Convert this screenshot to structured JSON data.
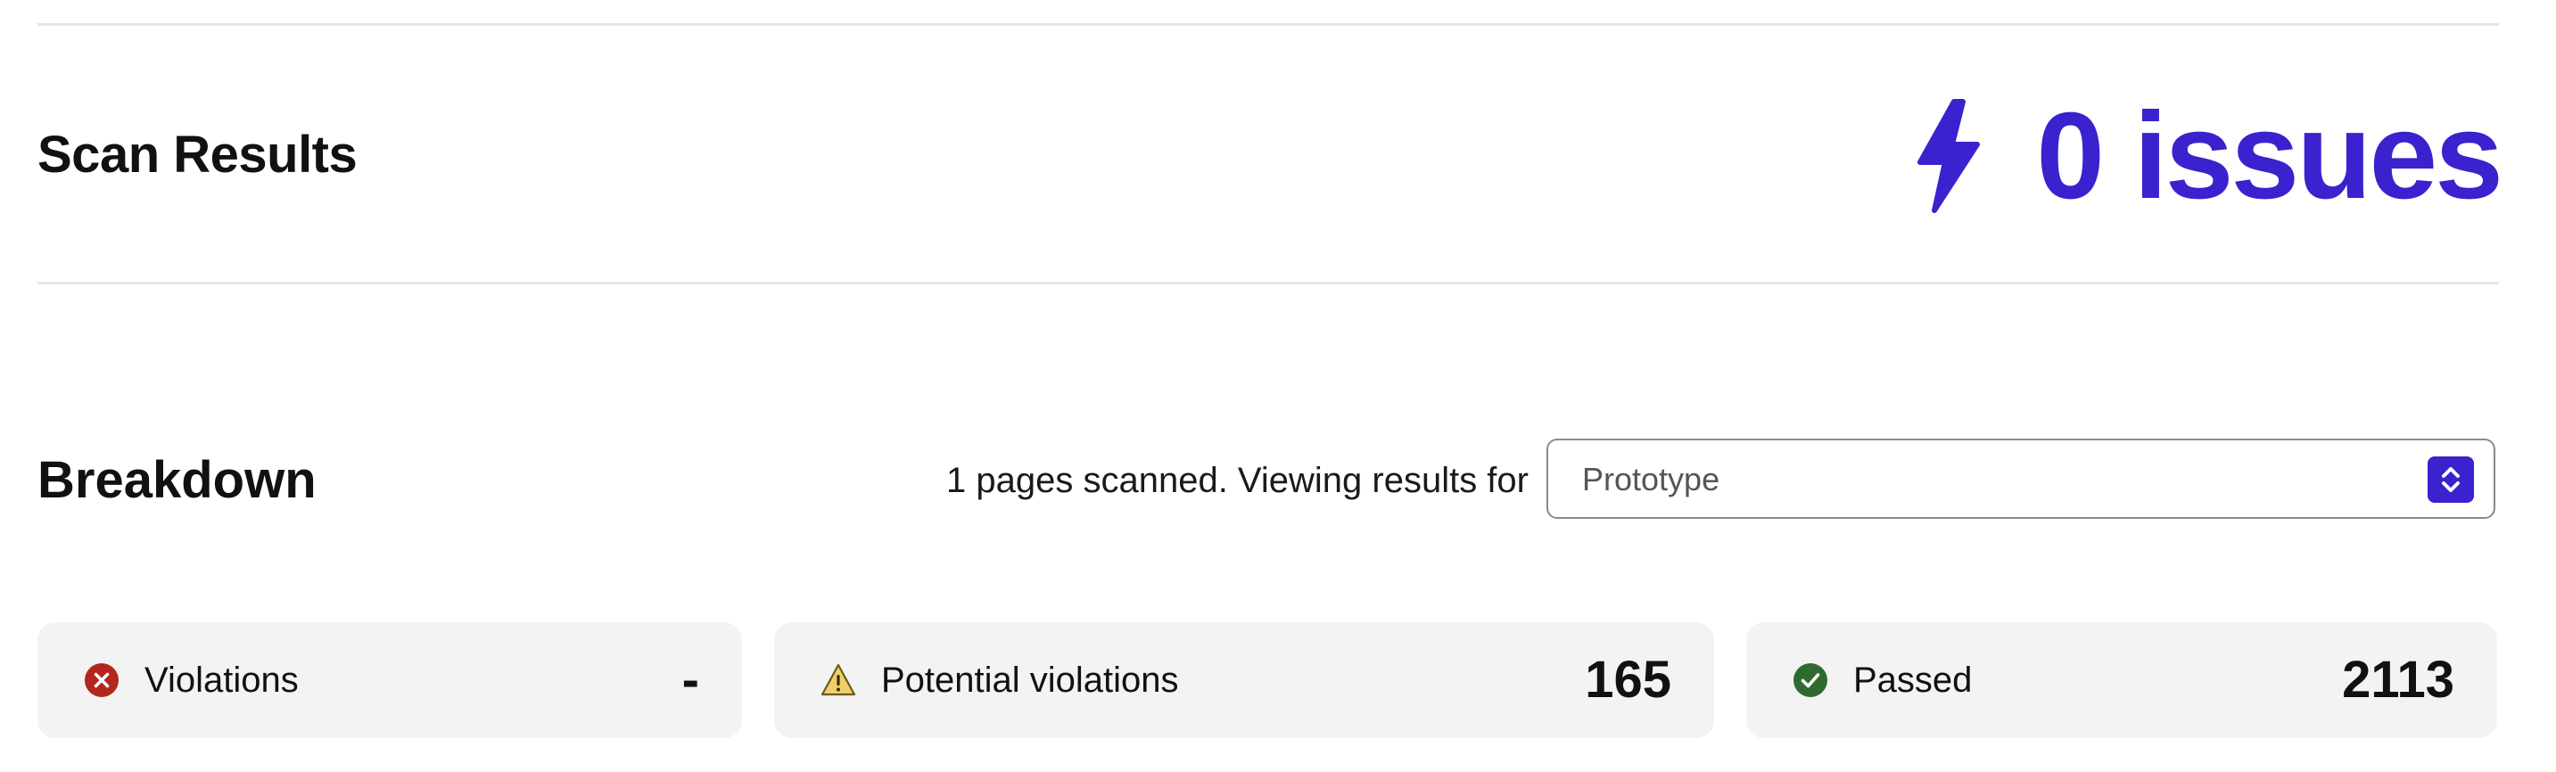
{
  "scan": {
    "title": "Scan Results",
    "issues_label": "0 issues",
    "accent_color": "#3a22cf",
    "icon": "lightning-bolt-icon"
  },
  "breakdown": {
    "title": "Breakdown",
    "scanned_text": "1 pages scanned. Viewing results for",
    "select": {
      "value": "Prototype",
      "icon": "chevron-up-down-icon"
    }
  },
  "cards": [
    {
      "label": "Violations",
      "value": "-",
      "icon": "error-circle-icon",
      "color": "#b3261e"
    },
    {
      "label": "Potential violations",
      "value": "165",
      "icon": "warning-triangle-icon",
      "color": "#e0b64a"
    },
    {
      "label": "Passed",
      "value": "2113",
      "icon": "check-circle-icon",
      "color": "#2f6b2f"
    }
  ]
}
